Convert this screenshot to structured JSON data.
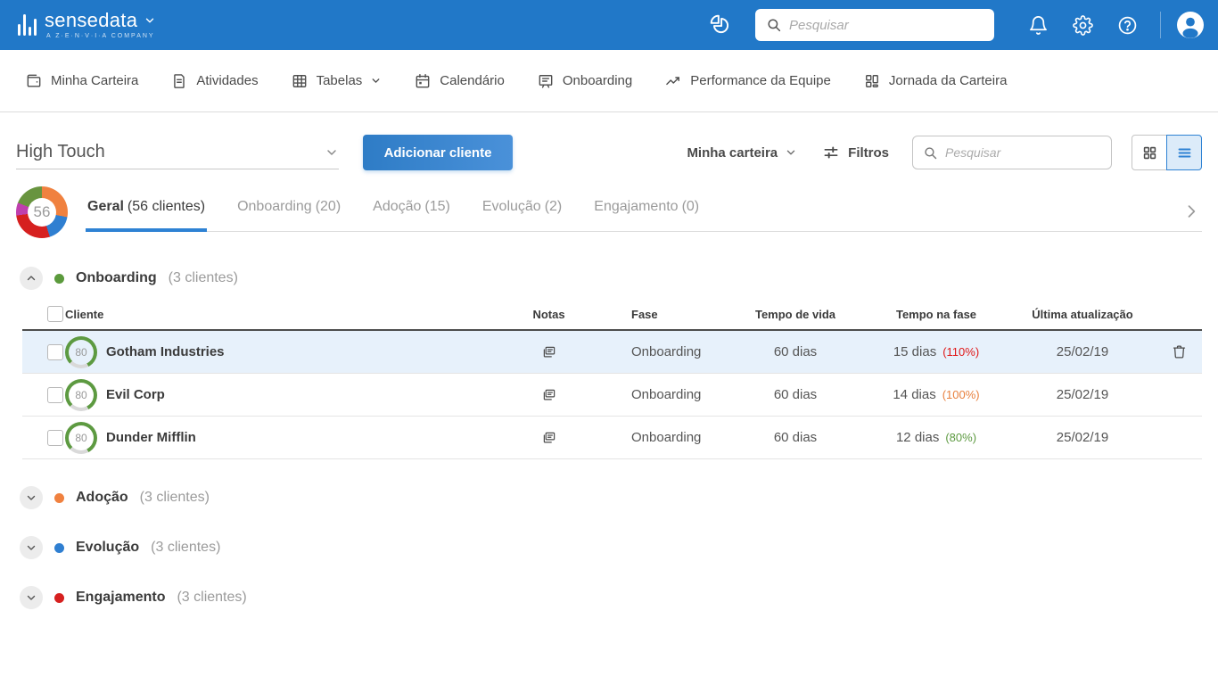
{
  "brand": {
    "name": "sensedata",
    "tagline": "A Z·E·N·V·I·A COMPANY"
  },
  "topbar": {
    "search_placeholder": "Pesquisar"
  },
  "nav": {
    "items": [
      {
        "label": "Minha Carteira"
      },
      {
        "label": "Atividades"
      },
      {
        "label": "Tabelas"
      },
      {
        "label": "Calendário"
      },
      {
        "label": "Onboarding"
      },
      {
        "label": "Performance da Equipe"
      },
      {
        "label": "Jornada da Carteira"
      }
    ]
  },
  "toolbar": {
    "segment_value": "High Touch",
    "add_client_label": "Adicionar cliente",
    "portfolio_value": "Minha carteira",
    "filters_label": "Filtros",
    "search_placeholder": "Pesquisar"
  },
  "donut": {
    "total": "56",
    "segments": [
      {
        "color": "#f0813f",
        "pct": 28
      },
      {
        "color": "#2f7fd1",
        "pct": 17
      },
      {
        "color": "#d6201f",
        "pct": 28
      },
      {
        "color": "#bf3fae",
        "pct": 8
      },
      {
        "color": "#68943f",
        "pct": 19
      }
    ]
  },
  "tabs": {
    "items": [
      {
        "label": "Geral",
        "count": "(56 clientes)"
      },
      {
        "label": "Onboarding",
        "count": "(20)"
      },
      {
        "label": "Adoção",
        "count": "(15)"
      },
      {
        "label": "Evolução",
        "count": "(2)"
      },
      {
        "label": "Engajamento",
        "count": "(0)"
      }
    ]
  },
  "sections": {
    "onboarding": {
      "label": "Onboarding",
      "count": "(3 clientes)",
      "color": "#5b9a3c"
    },
    "collapsed": [
      {
        "label": "Adoção",
        "count": "(3 clientes)",
        "color": "#f0813f"
      },
      {
        "label": "Evolução",
        "count": "(3 clientes)",
        "color": "#2f7fd1"
      },
      {
        "label": "Engajamento",
        "count": "(3 clientes)",
        "color": "#d6201f"
      }
    ]
  },
  "table": {
    "headers": {
      "cliente": "Cliente",
      "notas": "Notas",
      "fase": "Fase",
      "tempo_vida": "Tempo de vida",
      "tempo_fase": "Tempo na fase",
      "ultima": "Última atualização"
    },
    "rows": [
      {
        "score": "80",
        "score_pct": 80,
        "ring_color": "#5d9a41",
        "name": "Gotham Industries",
        "fase": "Onboarding",
        "tempo_vida": "60 dias",
        "tempo_fase": "15 dias",
        "pct": "(110%)",
        "pct_color": "#e01717",
        "updated": "25/02/19"
      },
      {
        "score": "80",
        "score_pct": 80,
        "ring_color": "#5d9a41",
        "name": "Evil Corp",
        "fase": "Onboarding",
        "tempo_vida": "60 dias",
        "tempo_fase": "14 dias",
        "pct": "(100%)",
        "pct_color": "#e8813f",
        "updated": "25/02/19"
      },
      {
        "score": "80",
        "score_pct": 80,
        "ring_color": "#5d9a41",
        "name": "Dunder Mifflin",
        "fase": "Onboarding",
        "tempo_vida": "60 dias",
        "tempo_fase": "12 dias",
        "pct": "(80%)",
        "pct_color": "#5d9a41",
        "updated": "25/02/19"
      }
    ]
  }
}
